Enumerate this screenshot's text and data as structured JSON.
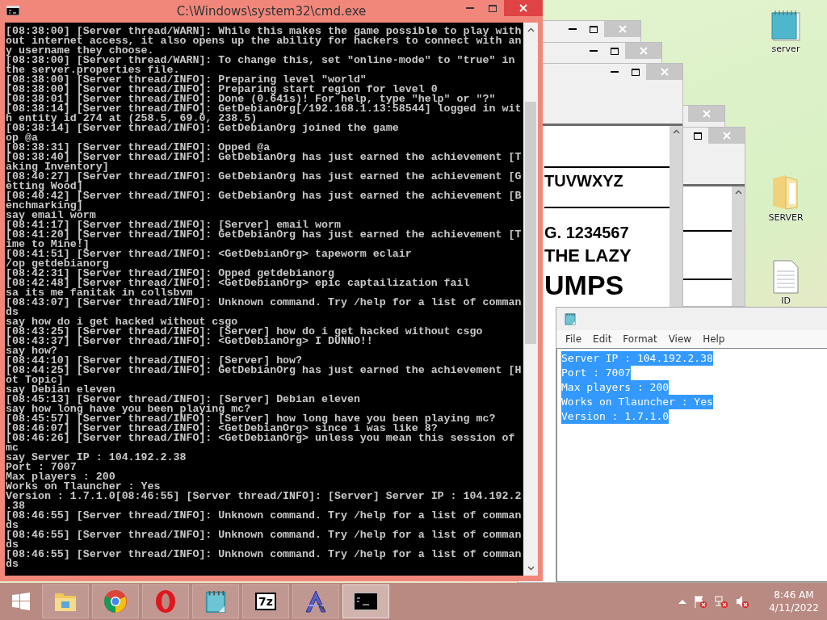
{
  "console_window": {
    "title": "C:\\Windows\\system32\\cmd.exe",
    "lines": [
      "[08:38:00] [Server thread/WARN]: While this makes the game possible to play with",
      "out internet access, it also opens up the ability for hackers to connect with an",
      "y username they choose.",
      "[08:38:00] [Server thread/WARN]: To change this, set \"online-mode\" to \"true\" in",
      "the server.properties file.",
      "[08:38:00] [Server thread/INFO]: Preparing level \"world\"",
      "[08:38:00] [Server thread/INFO]: Preparing start region for level 0",
      "[08:38:01] [Server thread/INFO]: Done (0.641s)! For help, type \"help\" or \"?\"",
      "[08:38:14] [Server thread/INFO]: GetDebianOrg[/192.168.1.13:58544] logged in wit",
      "h entity id 274 at (258.5, 69.0, 238.5)",
      "[08:38:14] [Server thread/INFO]: GetDebianOrg joined the game",
      "op @a",
      "[08:38:31] [Server thread/INFO]: Opped @a",
      "[08:38:40] [Server thread/INFO]: GetDebianOrg has just earned the achievement [T",
      "aking Inventory]",
      "[08:40:27] [Server thread/INFO]: GetDebianOrg has just earned the achievement [G",
      "etting Wood]",
      "[08:40:42] [Server thread/INFO]: GetDebianOrg has just earned the achievement [B",
      "enchmarking]",
      "say email worm",
      "[08:41:17] [Server thread/INFO]: [Server] email worm",
      "[08:41:20] [Server thread/INFO]: GetDebianOrg has just earned the achievement [T",
      "ime to Mine!]",
      "[08:41:51] [Server thread/INFO]: <GetDebianOrg> tapeworm eclair",
      "/op getdebianorg",
      "[08:42:31] [Server thread/INFO]: Opped getdebianorg",
      "[08:42:48] [Server thread/INFO]: <GetDebianOrg> epic captailization fail",
      "sa its me fanitak in collsbvm",
      "[08:43:07] [Server thread/INFO]: Unknown command. Try /help for a list of comman",
      "ds",
      "say how do i get hacked without csgo",
      "[08:43:25] [Server thread/INFO]: [Server] how do i get hacked without csgo",
      "[08:43:37] [Server thread/INFO]: <GetDebianOrg> I DUNNO!!",
      "say how?",
      "[08:44:10] [Server thread/INFO]: [Server] how?",
      "[08:44:25] [Server thread/INFO]: GetDebianOrg has just earned the achievement [H",
      "ot Topic]",
      "say Debian eleven",
      "[08:45:13] [Server thread/INFO]: [Server] Debian eleven",
      "say how long have you been playing mc?",
      "[08:45:57] [Server thread/INFO]: [Server] how long have you been playing mc?",
      "[08:46:07] [Server thread/INFO]: <GetDebianOrg> since i was like 8?",
      "[08:46:26] [Server thread/INFO]: <GetDebianOrg> unless you mean this session of",
      "mc",
      "say Server IP : 104.192.2.38",
      "Port : 7007",
      "Max players : 200",
      "Works on Tlauncher : Yes",
      "Version : 1.7.1.0[08:46:55] [Server thread/INFO]: [Server] Server IP : 104.192.2",
      ".38",
      "[08:46:55] [Server thread/INFO]: Unknown command. Try /help for a list of comman",
      "ds",
      "[08:46:55] [Server thread/INFO]: Unknown command. Try /help for a list of comman",
      "ds",
      "[08:46:55] [Server thread/INFO]: Unknown command. Try /help for a list of comman",
      "ds"
    ]
  },
  "font_viewer": {
    "sample_lines": [
      "TUVWXYZ",
      "G. 1234567",
      "THE LAZY",
      "UMPS"
    ]
  },
  "notepad": {
    "menu": [
      "File",
      "Edit",
      "Format",
      "View",
      "Help"
    ],
    "selected": true,
    "lines": [
      "Server IP : 104.192.2.38",
      "Port : 7007",
      "Max players : 200",
      "Works on Tlauncher : Yes",
      "Version : 1.7.1.0"
    ]
  },
  "desktop_icons": [
    {
      "label": "server",
      "kind": "notepad"
    },
    {
      "label": "SERVER",
      "kind": "folder"
    },
    {
      "label": "ID",
      "kind": "file"
    }
  ],
  "taskbar": {
    "apps": [
      {
        "kind": "explorer",
        "selected": false
      },
      {
        "kind": "chrome",
        "selected": false
      },
      {
        "kind": "opera",
        "selected": false
      },
      {
        "kind": "notepad",
        "selected": false
      },
      {
        "kind": "archiver",
        "label": "7z",
        "selected": false
      },
      {
        "kind": "paint",
        "selected": false
      },
      {
        "kind": "console",
        "selected": true
      }
    ],
    "clock": {
      "time": "8:46 AM",
      "date": "4/11/2022"
    }
  }
}
